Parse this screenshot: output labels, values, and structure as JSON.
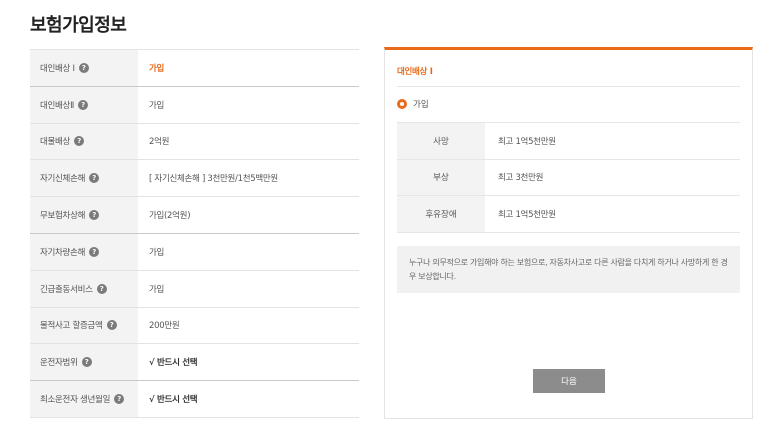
{
  "page": {
    "title": "보험가입정보"
  },
  "coverage": {
    "help_glyph": "?",
    "rows": [
      {
        "label": "대인배상 I",
        "value": "가입"
      },
      {
        "label": "대인배상Ⅱ",
        "value": "가입"
      },
      {
        "label": "대물배상",
        "value": "2억원"
      },
      {
        "label": "자기신체손해",
        "value": "[ 자기신체손해 ]  3천만원/1천5백만원"
      },
      {
        "label": "무보험차상해",
        "value": "가입(2억원)"
      },
      {
        "label": "자기차량손해",
        "value": "가입"
      },
      {
        "label": "긴급출동서비스",
        "value": "가입"
      },
      {
        "label": "물적사고 할증금액",
        "value": "200만원"
      },
      {
        "label": "운전자범위",
        "value": "√ 반드시 선택"
      },
      {
        "label": "최소운전자 생년월일",
        "value": "√ 반드시 선택"
      }
    ]
  },
  "detail": {
    "title": "대인배상 I",
    "option_label": "가입",
    "limits": [
      {
        "label": "사망",
        "value": "최고 1억5천만원"
      },
      {
        "label": "부상",
        "value": "최고 3천만원"
      },
      {
        "label": "후유장애",
        "value": "최고 1억5천만원"
      }
    ],
    "description": "누구나 의무적으로 가입해야 하는 보험으로, 자동차사고로 다른 사람을 다치게 하거나 사망하게 한 경우 보상합니다.",
    "next_label": "다음"
  },
  "colors": {
    "accent": "#e96b1a",
    "button": "#8c8c8c",
    "label_bg": "#f3f3f3"
  }
}
